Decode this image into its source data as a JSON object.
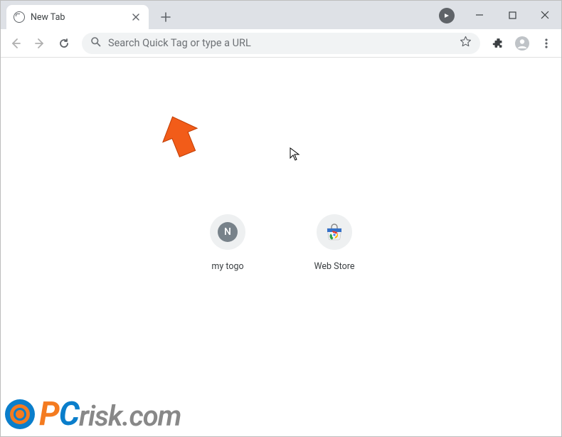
{
  "window": {
    "minimize_tooltip": "Minimize",
    "maximize_tooltip": "Maximize",
    "close_tooltip": "Close"
  },
  "tab": {
    "title": "New Tab"
  },
  "toolbar": {
    "back_tooltip": "Back",
    "forward_tooltip": "Forward",
    "reload_tooltip": "Reload",
    "bookmark_tooltip": "Bookmark this page",
    "extensions_tooltip": "Extensions",
    "profile_tooltip": "Profile",
    "menu_tooltip": "Menu"
  },
  "omnibox": {
    "placeholder": "Search Quick Tag or type a URL",
    "value": ""
  },
  "shortcuts": [
    {
      "label": "my togo",
      "initial": "N",
      "kind": "letter"
    },
    {
      "label": "Web Store",
      "kind": "webstore"
    }
  ],
  "watermark": {
    "p": "P",
    "c": "C",
    "rest": "risk.com"
  }
}
